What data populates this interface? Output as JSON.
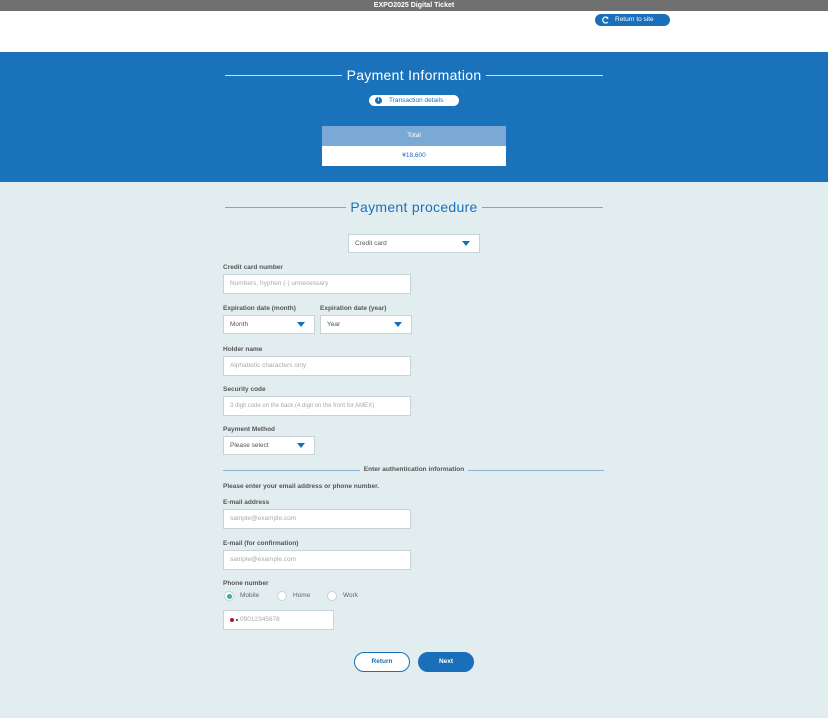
{
  "topbar": {
    "title": "EXPO2025 Digital Ticket"
  },
  "header": {
    "return_label": "Return to site",
    "return_icon": "return-arrow-icon"
  },
  "payment_info": {
    "title": "Payment Information",
    "transaction_details_label": "Transaction details",
    "info_icon": "info-icon",
    "total_label": "Total",
    "total_value": "¥18,600"
  },
  "procedure": {
    "title": "Payment procedure",
    "payment_type": {
      "selected": "Credit card"
    },
    "card_number": {
      "label": "Credit card number",
      "placeholder": "Numbers, hyphen (-) unnecessary"
    },
    "exp_month": {
      "label": "Expiration date (month)",
      "selected": "Month"
    },
    "exp_year": {
      "label": "Expiration date (year)",
      "selected": "Year"
    },
    "holder": {
      "label": "Holder name",
      "placeholder": "Alphabetic characters only"
    },
    "security": {
      "label": "Security code",
      "placeholder": "3 digit code on the back (4 digit on the front for AMEX)"
    },
    "method": {
      "label": "Payment Method",
      "selected": "Please select"
    }
  },
  "auth": {
    "divider_label": "Enter authentication information",
    "instruction": "Please enter your email address or phone number.",
    "email": {
      "label": "E-mail address",
      "placeholder": "sample@example.com"
    },
    "email_confirm": {
      "label": "E-mail (for confirmation)",
      "placeholder": "sample@example.com"
    },
    "phone": {
      "label": "Phone number",
      "options": [
        "Mobile",
        "Home",
        "Work"
      ],
      "selected": "Mobile",
      "placeholder": "09012345678"
    }
  },
  "buttons": {
    "return": "Return",
    "next": "Next"
  },
  "colors": {
    "primary": "#1a72bb",
    "form_bg": "#e2edf0",
    "radio_on": "#3ab18a"
  }
}
